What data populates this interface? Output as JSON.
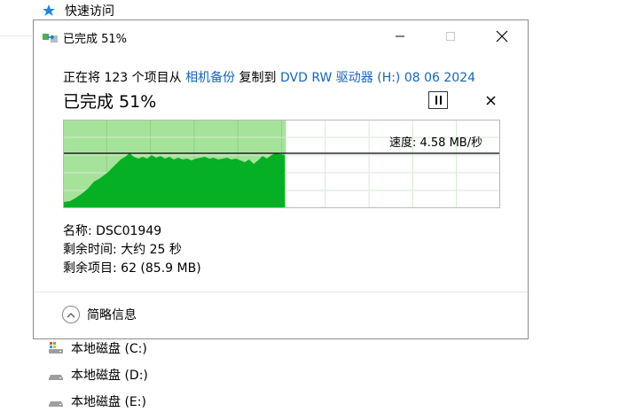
{
  "explorer": {
    "quick_access": "快速访问",
    "drives": [
      "本地磁盘 (C:)",
      "本地磁盘 (D:)",
      "本地磁盘 (E:)"
    ]
  },
  "dialog": {
    "title": "已完成 51%",
    "summary": {
      "prefix": "正在将 123 个项目从",
      "source": "相机备份",
      "middle": "复制到",
      "destination": "DVD RW 驱动器 (H:) 08 06 2024"
    },
    "progress_title": "已完成 51%",
    "progress_fraction": 0.51,
    "speed": "速度: 4.58 MB/秒",
    "details": {
      "name": "名称: DSC01949",
      "time_remaining": "剩余时间: 大约 25 秒",
      "items_remaining": "剩余项目: 62 (85.9 MB)"
    },
    "more_info": "简略信息"
  },
  "colors": {
    "accent_link": "#1565c0",
    "graph_fill": "#06b025",
    "graph_bg_done": "#a6e39a",
    "quick_access_star": "#1e88e5"
  },
  "icons": {
    "quick_access": "star-icon",
    "title": "copy-icon",
    "pause": "pause-icon",
    "cancel": "close-icon",
    "more": "chevron-up-icon",
    "drive": "drive-icon"
  }
}
